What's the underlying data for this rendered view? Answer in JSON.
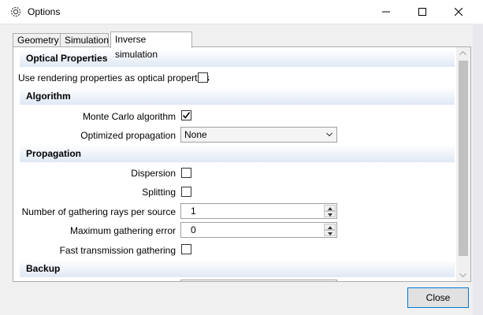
{
  "window": {
    "title": "Options",
    "icons": {
      "app": "gear-icon",
      "minimize": "minimize-icon",
      "maximize": "maximize-icon",
      "close": "close-icon"
    }
  },
  "tabs": [
    {
      "label": "Geometry",
      "active": false
    },
    {
      "label": "Simulation",
      "active": false
    },
    {
      "label": "Inverse simulation",
      "active": true
    }
  ],
  "sections": {
    "optical": {
      "header": "Optical Properties",
      "use_rendering_label": "Use rendering properties as optical properties",
      "use_rendering_checked": false
    },
    "algorithm": {
      "header": "Algorithm",
      "monte_carlo_label": "Monte Carlo algorithm",
      "monte_carlo_checked": true,
      "optimized_propagation_label": "Optimized propagation",
      "optimized_propagation_value": "None"
    },
    "propagation": {
      "header": "Propagation",
      "dispersion_label": "Dispersion",
      "dispersion_checked": false,
      "splitting_label": "Splitting",
      "splitting_checked": false,
      "gathering_rays_label": "Number of gathering rays per source",
      "gathering_rays_value": "1",
      "max_gathering_error_label": "Maximum gathering error",
      "max_gathering_error_value": "0",
      "fast_transmission_label": "Fast transmission gathering",
      "fast_transmission_checked": false
    },
    "backup": {
      "header": "Backup"
    }
  },
  "footer": {
    "close_label": "Close"
  }
}
